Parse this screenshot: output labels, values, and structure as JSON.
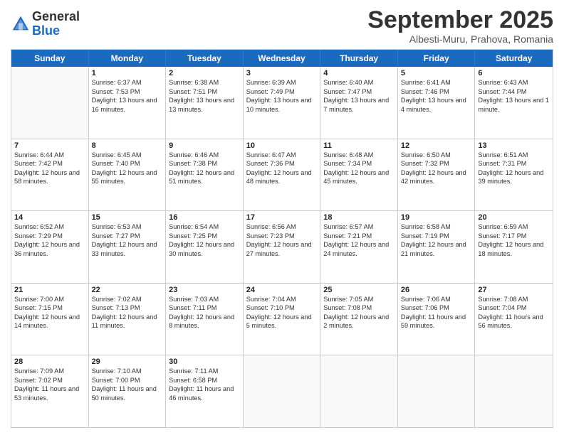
{
  "logo": {
    "general": "General",
    "blue": "Blue"
  },
  "title": "September 2025",
  "subtitle": "Albesti-Muru, Prahova, Romania",
  "days": [
    "Sunday",
    "Monday",
    "Tuesday",
    "Wednesday",
    "Thursday",
    "Friday",
    "Saturday"
  ],
  "weeks": [
    [
      {
        "day": "",
        "empty": true
      },
      {
        "day": "1",
        "sunrise": "Sunrise: 6:37 AM",
        "sunset": "Sunset: 7:53 PM",
        "daylight": "Daylight: 13 hours and 16 minutes."
      },
      {
        "day": "2",
        "sunrise": "Sunrise: 6:38 AM",
        "sunset": "Sunset: 7:51 PM",
        "daylight": "Daylight: 13 hours and 13 minutes."
      },
      {
        "day": "3",
        "sunrise": "Sunrise: 6:39 AM",
        "sunset": "Sunset: 7:49 PM",
        "daylight": "Daylight: 13 hours and 10 minutes."
      },
      {
        "day": "4",
        "sunrise": "Sunrise: 6:40 AM",
        "sunset": "Sunset: 7:47 PM",
        "daylight": "Daylight: 13 hours and 7 minutes."
      },
      {
        "day": "5",
        "sunrise": "Sunrise: 6:41 AM",
        "sunset": "Sunset: 7:46 PM",
        "daylight": "Daylight: 13 hours and 4 minutes."
      },
      {
        "day": "6",
        "sunrise": "Sunrise: 6:43 AM",
        "sunset": "Sunset: 7:44 PM",
        "daylight": "Daylight: 13 hours and 1 minute."
      }
    ],
    [
      {
        "day": "7",
        "sunrise": "Sunrise: 6:44 AM",
        "sunset": "Sunset: 7:42 PM",
        "daylight": "Daylight: 12 hours and 58 minutes."
      },
      {
        "day": "8",
        "sunrise": "Sunrise: 6:45 AM",
        "sunset": "Sunset: 7:40 PM",
        "daylight": "Daylight: 12 hours and 55 minutes."
      },
      {
        "day": "9",
        "sunrise": "Sunrise: 6:46 AM",
        "sunset": "Sunset: 7:38 PM",
        "daylight": "Daylight: 12 hours and 51 minutes."
      },
      {
        "day": "10",
        "sunrise": "Sunrise: 6:47 AM",
        "sunset": "Sunset: 7:36 PM",
        "daylight": "Daylight: 12 hours and 48 minutes."
      },
      {
        "day": "11",
        "sunrise": "Sunrise: 6:48 AM",
        "sunset": "Sunset: 7:34 PM",
        "daylight": "Daylight: 12 hours and 45 minutes."
      },
      {
        "day": "12",
        "sunrise": "Sunrise: 6:50 AM",
        "sunset": "Sunset: 7:32 PM",
        "daylight": "Daylight: 12 hours and 42 minutes."
      },
      {
        "day": "13",
        "sunrise": "Sunrise: 6:51 AM",
        "sunset": "Sunset: 7:31 PM",
        "daylight": "Daylight: 12 hours and 39 minutes."
      }
    ],
    [
      {
        "day": "14",
        "sunrise": "Sunrise: 6:52 AM",
        "sunset": "Sunset: 7:29 PM",
        "daylight": "Daylight: 12 hours and 36 minutes."
      },
      {
        "day": "15",
        "sunrise": "Sunrise: 6:53 AM",
        "sunset": "Sunset: 7:27 PM",
        "daylight": "Daylight: 12 hours and 33 minutes."
      },
      {
        "day": "16",
        "sunrise": "Sunrise: 6:54 AM",
        "sunset": "Sunset: 7:25 PM",
        "daylight": "Daylight: 12 hours and 30 minutes."
      },
      {
        "day": "17",
        "sunrise": "Sunrise: 6:56 AM",
        "sunset": "Sunset: 7:23 PM",
        "daylight": "Daylight: 12 hours and 27 minutes."
      },
      {
        "day": "18",
        "sunrise": "Sunrise: 6:57 AM",
        "sunset": "Sunset: 7:21 PM",
        "daylight": "Daylight: 12 hours and 24 minutes."
      },
      {
        "day": "19",
        "sunrise": "Sunrise: 6:58 AM",
        "sunset": "Sunset: 7:19 PM",
        "daylight": "Daylight: 12 hours and 21 minutes."
      },
      {
        "day": "20",
        "sunrise": "Sunrise: 6:59 AM",
        "sunset": "Sunset: 7:17 PM",
        "daylight": "Daylight: 12 hours and 18 minutes."
      }
    ],
    [
      {
        "day": "21",
        "sunrise": "Sunrise: 7:00 AM",
        "sunset": "Sunset: 7:15 PM",
        "daylight": "Daylight: 12 hours and 14 minutes."
      },
      {
        "day": "22",
        "sunrise": "Sunrise: 7:02 AM",
        "sunset": "Sunset: 7:13 PM",
        "daylight": "Daylight: 12 hours and 11 minutes."
      },
      {
        "day": "23",
        "sunrise": "Sunrise: 7:03 AM",
        "sunset": "Sunset: 7:11 PM",
        "daylight": "Daylight: 12 hours and 8 minutes."
      },
      {
        "day": "24",
        "sunrise": "Sunrise: 7:04 AM",
        "sunset": "Sunset: 7:10 PM",
        "daylight": "Daylight: 12 hours and 5 minutes."
      },
      {
        "day": "25",
        "sunrise": "Sunrise: 7:05 AM",
        "sunset": "Sunset: 7:08 PM",
        "daylight": "Daylight: 12 hours and 2 minutes."
      },
      {
        "day": "26",
        "sunrise": "Sunrise: 7:06 AM",
        "sunset": "Sunset: 7:06 PM",
        "daylight": "Daylight: 11 hours and 59 minutes."
      },
      {
        "day": "27",
        "sunrise": "Sunrise: 7:08 AM",
        "sunset": "Sunset: 7:04 PM",
        "daylight": "Daylight: 11 hours and 56 minutes."
      }
    ],
    [
      {
        "day": "28",
        "sunrise": "Sunrise: 7:09 AM",
        "sunset": "Sunset: 7:02 PM",
        "daylight": "Daylight: 11 hours and 53 minutes."
      },
      {
        "day": "29",
        "sunrise": "Sunrise: 7:10 AM",
        "sunset": "Sunset: 7:00 PM",
        "daylight": "Daylight: 11 hours and 50 minutes."
      },
      {
        "day": "30",
        "sunrise": "Sunrise: 7:11 AM",
        "sunset": "Sunset: 6:58 PM",
        "daylight": "Daylight: 11 hours and 46 minutes."
      },
      {
        "day": "",
        "empty": true
      },
      {
        "day": "",
        "empty": true
      },
      {
        "day": "",
        "empty": true
      },
      {
        "day": "",
        "empty": true
      }
    ]
  ]
}
